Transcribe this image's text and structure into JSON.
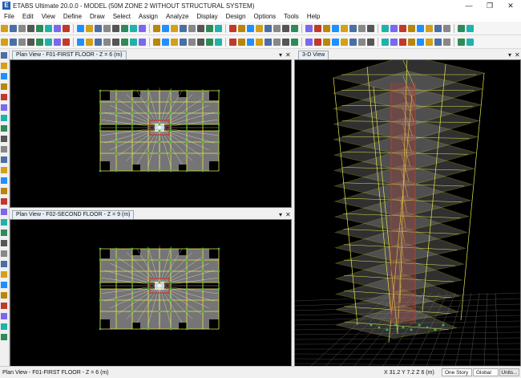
{
  "window": {
    "title": "ETABS Ultimate 20.0.0 - MODEL (50M ZONE 2 WITHOUT STRUCTURAL SYSTEM)",
    "app_icon_letter": "E",
    "controls": {
      "minimize": "—",
      "restore": "❐",
      "close": "✕"
    }
  },
  "menu": [
    "File",
    "Edit",
    "View",
    "Define",
    "Draw",
    "Select",
    "Assign",
    "Analyze",
    "Display",
    "Design",
    "Options",
    "Tools",
    "Help"
  ],
  "panes": {
    "plan1": {
      "tab": "Plan View - F01-FIRST FLOOR - Z = 6 (m)",
      "close": "✕",
      "pin": "▾"
    },
    "plan2": {
      "tab": "Plan View - F02-SECOND FLOOR - Z = 9 (m)",
      "close": "✕",
      "pin": "▾"
    },
    "view3d": {
      "tab": "3-D View",
      "close": "✕",
      "pin": "▾"
    }
  },
  "colors": {
    "frame": "#e6e64a",
    "slab": "#8a8a8a",
    "brace": "#ffffff",
    "column": "#2fb84a",
    "wall": "#c0392b"
  },
  "status": {
    "left": "Plan View - F01-FIRST FLOOR - Z = 6 (m)",
    "coords": "X 31.2  Y 7.2  Z 6 (m)",
    "story_option": "One Story",
    "coord_system": "Global",
    "units_button": "Units..."
  }
}
